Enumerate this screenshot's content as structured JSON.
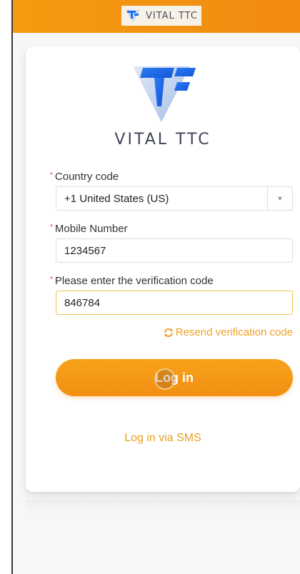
{
  "header": {
    "brand": "VITAL TTC"
  },
  "card": {
    "brand_name": "VITAL TTC",
    "country_code": {
      "label": "Country code",
      "value": "+1 United States (US)"
    },
    "mobile": {
      "label": "Mobile Number",
      "value": "1234567"
    },
    "verification": {
      "label": "Please enter the verification code",
      "value": "846784"
    },
    "resend_label": "Resend verification code",
    "login_button": "Log in",
    "sms_link": "Log in via SMS"
  },
  "colors": {
    "accent": "#f39212",
    "link": "#f0a020",
    "required": "#e63b2e",
    "logo_blue": "#1a6ff0"
  },
  "icons": [
    "vital-ttc-logo-icon",
    "chevron-down-icon",
    "refresh-icon"
  ]
}
